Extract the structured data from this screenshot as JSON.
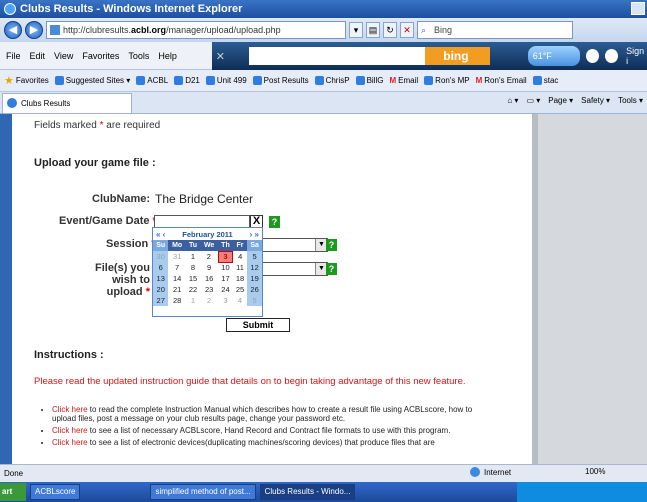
{
  "window": {
    "title": "Clubs Results - Windows Internet Explorer"
  },
  "address": {
    "url_prefix": "http://clubresults.",
    "url_domain": "acbl.org",
    "url_path": "/manager/upload/upload.php",
    "search_placeholder": "Bing"
  },
  "menu": [
    "File",
    "Edit",
    "View",
    "Favorites",
    "Tools",
    "Help"
  ],
  "bing": {
    "logo": "bing",
    "temperature": "61°F",
    "signin": "Sign i"
  },
  "favorites": {
    "label": "Favorites",
    "items": [
      "Suggested Sites ▾",
      "ACBL",
      "D21",
      "Unit 499",
      "Post Results",
      "ChrisP",
      "BillG",
      "Email",
      "Ron's MP",
      "Ron's Email",
      "stac"
    ]
  },
  "tab": {
    "label": "Clubs Results"
  },
  "commands": [
    "Page ▾",
    "Safety ▾",
    "Tools ▾"
  ],
  "form": {
    "required_note": "Fields marked",
    "required_note_end": "are required",
    "asterisk": "*",
    "upload_heading": "Upload your game file :",
    "club_label": "ClubName:",
    "club_value": "The Bridge Center",
    "date_label": "Event/Game Date",
    "session_label": "Session",
    "files_label_1": "File(s) you wish to",
    "files_label_2": "upload",
    "clear": "X",
    "help": "?",
    "submit": "Submit"
  },
  "calendar": {
    "prev": "«  ‹",
    "next": "›  »",
    "month": "February 2011",
    "days": [
      "Su",
      "Mo",
      "Tu",
      "We",
      "Th",
      "Fr",
      "Sa"
    ],
    "weeks": [
      [
        "30",
        "31",
        "1",
        "2",
        "3",
        "4",
        "5"
      ],
      [
        "6",
        "7",
        "8",
        "9",
        "10",
        "11",
        "12"
      ],
      [
        "13",
        "14",
        "15",
        "16",
        "17",
        "18",
        "19"
      ],
      [
        "20",
        "21",
        "22",
        "23",
        "24",
        "25",
        "26"
      ],
      [
        "27",
        "28",
        "1",
        "2",
        "3",
        "4",
        "5"
      ]
    ],
    "today": "3"
  },
  "instructions": {
    "heading": "Instructions :",
    "notice": "Please read the updated instruction guide that details on to begin taking advantage of this new feature.",
    "bullets": [
      {
        "link": "Click here",
        "text": " to read the complete Instruction Manual which describes how to create a result file using ACBLscore, how to upload files, post a message on your club results page, change your password etc."
      },
      {
        "link": "Click here",
        "text": " to see a list of necessary ACBLscore, Hand Record and Contract file formats to use with this program."
      },
      {
        "link": "Click here",
        "text": " to see a list of electronic devices(duplicating machines/scoring devices) that produce files that are"
      }
    ]
  },
  "status": {
    "left": "Done",
    "zone": "Internet",
    "zoom": "100%"
  },
  "taskbar": {
    "start": "art",
    "items": [
      "ACBLscore",
      "simplified method of post...",
      "Clubs Results - Windo..."
    ]
  }
}
